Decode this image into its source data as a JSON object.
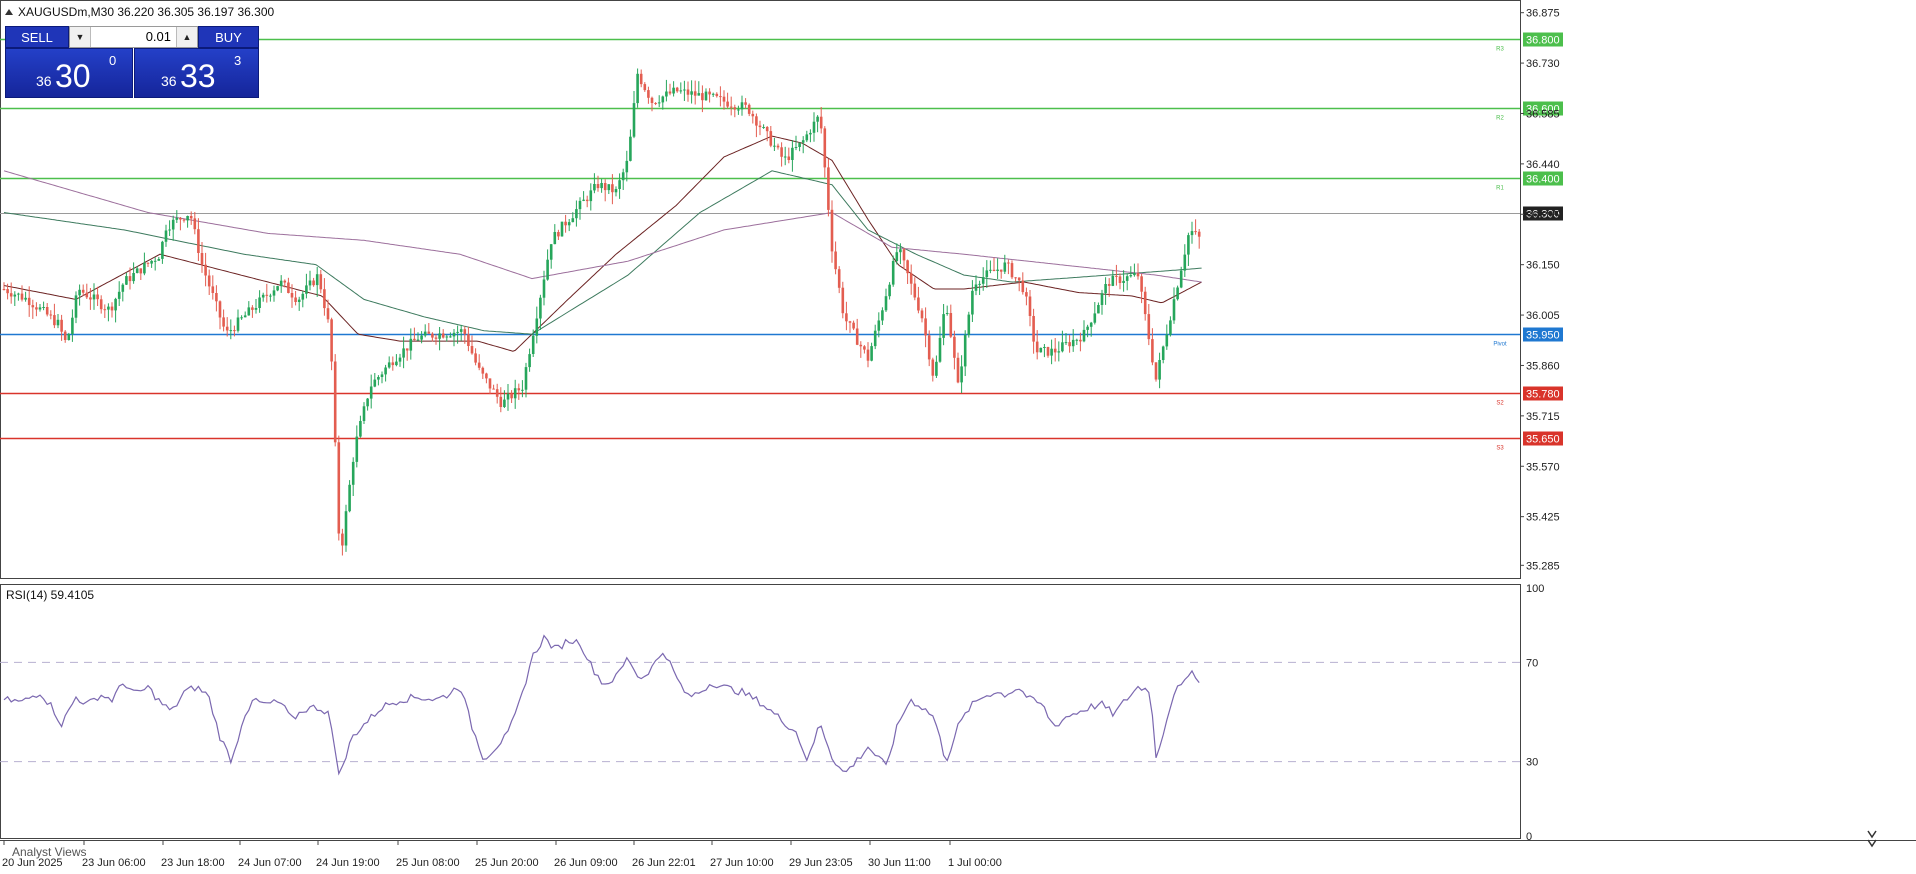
{
  "header": {
    "symbol_line": "XAUGUSDm,M30  36.220 36.305 36.197 36.300",
    "collapse_icon": "triangle-up-icon"
  },
  "trade_panel": {
    "sell_label": "SELL",
    "buy_label": "BUY",
    "lot_value": "0.01",
    "bid": {
      "small": "36",
      "big": "30",
      "sup": "0"
    },
    "ask": {
      "small": "36",
      "big": "33",
      "sup": "3"
    }
  },
  "price_axis": {
    "ticks": [
      "36.875",
      "36.730",
      "36.585",
      "36.440",
      "36.295",
      "36.150",
      "36.005",
      "35.860",
      "35.715",
      "35.570",
      "35.425",
      "35.285"
    ],
    "current_price": "36.300",
    "current_price_color": "#222222"
  },
  "levels": [
    {
      "id": "r3",
      "price": 36.8,
      "label": "36.800",
      "tag": "R3",
      "color": "#4cbf4c"
    },
    {
      "id": "r2",
      "price": 36.6,
      "label": "36.600",
      "tag": "R2",
      "color": "#4cbf4c"
    },
    {
      "id": "r1",
      "price": 36.4,
      "label": "36.400",
      "tag": "R1",
      "color": "#4cbf4c"
    },
    {
      "id": "pivot",
      "price": 35.95,
      "label": "35.950",
      "tag": "Pivot",
      "color": "#1f78d1"
    },
    {
      "id": "s2",
      "price": 35.78,
      "label": "35.780",
      "tag": "S2",
      "color": "#d9342b"
    },
    {
      "id": "s3",
      "price": 35.65,
      "label": "35.650",
      "tag": "S3",
      "color": "#d9342b"
    }
  ],
  "time_axis": [
    "20 Jun 2025",
    "23 Jun 06:00",
    "23 Jun 18:00",
    "24 Jun 07:00",
    "24 Jun 19:00",
    "25 Jun 08:00",
    "25 Jun 20:00",
    "26 Jun 09:00",
    "26 Jun 22:01",
    "27 Jun 10:00",
    "29 Jun 23:05",
    "30 Jun 11:00",
    "1 Jul 00:00"
  ],
  "rsi": {
    "label": "RSI(14) 59.4105",
    "ticks": [
      "100",
      "70",
      "30",
      "0"
    ],
    "color": "#7b68b0"
  },
  "bottom_bar": {
    "label": "Analyst Views"
  },
  "chart_data": [
    {
      "type": "candlestick",
      "symbol": "XAUGUSDm",
      "timeframe": "M30",
      "ylim": [
        35.26,
        36.9
      ],
      "grid": false,
      "candle_colors": {
        "up": "#26a65b",
        "down": "#e35d50"
      },
      "price_anchors": {
        "t": [
          0,
          20,
          45,
          52,
          62,
          88,
          100,
          130,
          135,
          155,
          165,
          175,
          185,
          200,
          230,
          245,
          262,
          272,
          280,
          292,
          305,
          325,
          345,
          360,
          383,
          395,
          415,
          432,
          456,
          470,
          495,
          510,
          520,
          528,
          540,
          560,
          590,
          620,
          650,
          665,
          672,
          680,
          690,
          700,
          720,
          730,
          745,
          765,
          775,
          785,
          795,
          808,
          835,
          850,
          860,
          875,
          900,
          920,
          945,
          960,
          975,
          988,
          998
        ],
        "price": [
          36.08,
          36.05,
          35.98,
          35.92,
          36.08,
          36.02,
          36.1,
          36.18,
          36.26,
          36.3,
          36.15,
          36.05,
          35.95,
          36.0,
          36.1,
          36.05,
          36.12,
          35.95,
          35.3,
          35.62,
          35.8,
          35.88,
          35.94,
          35.95,
          35.96,
          35.85,
          35.75,
          35.8,
          36.22,
          36.28,
          36.38,
          36.36,
          36.45,
          36.7,
          36.62,
          36.65,
          36.63,
          36.6,
          36.45,
          36.5,
          36.54,
          36.58,
          36.2,
          36.0,
          35.88,
          36.0,
          36.2,
          36.0,
          35.82,
          36.05,
          35.8,
          36.1,
          36.15,
          36.08,
          35.9,
          35.9,
          35.95,
          36.1,
          36.12,
          35.82,
          36.05,
          36.25,
          36.22
        ]
      },
      "moving_averages": [
        {
          "color": "#6b2222",
          "t": [
            0,
            60,
            130,
            175,
            220,
            265,
            295,
            330,
            395,
            425,
            440,
            470,
            510,
            560,
            600,
            640,
            665,
            690,
            720,
            745,
            775,
            800,
            850,
            895,
            940,
            965,
            998
          ],
          "price": [
            36.09,
            36.05,
            36.18,
            36.14,
            36.1,
            36.06,
            35.95,
            35.93,
            35.93,
            35.9,
            35.95,
            36.05,
            36.18,
            36.32,
            36.46,
            36.52,
            36.5,
            36.45,
            36.28,
            36.15,
            36.08,
            36.08,
            36.1,
            36.07,
            36.06,
            36.04,
            36.1
          ]
        },
        {
          "color": "#3d7a5e",
          "t": [
            0,
            100,
            200,
            260,
            300,
            350,
            400,
            440,
            520,
            580,
            640,
            690,
            720,
            760,
            800,
            840,
            880,
            920,
            960,
            998
          ],
          "price": [
            36.3,
            36.25,
            36.18,
            36.15,
            36.05,
            36.0,
            35.96,
            35.95,
            36.12,
            36.3,
            36.42,
            36.38,
            36.25,
            36.18,
            36.12,
            36.1,
            36.11,
            36.12,
            36.13,
            36.14
          ]
        },
        {
          "color": "#9c6f9c",
          "t": [
            0,
            120,
            220,
            300,
            380,
            440,
            520,
            600,
            690,
            740,
            800,
            880,
            960,
            998
          ],
          "price": [
            36.42,
            36.3,
            36.24,
            36.22,
            36.18,
            36.11,
            36.16,
            36.25,
            36.3,
            36.2,
            36.18,
            36.15,
            36.12,
            36.1
          ]
        }
      ]
    },
    {
      "type": "line",
      "name": "RSI(14)",
      "ylim": [
        0,
        100
      ],
      "levels": [
        70,
        30
      ],
      "x": [
        0,
        15,
        30,
        40,
        48,
        60,
        70,
        80,
        90,
        100,
        110,
        120,
        130,
        140,
        150,
        160,
        170,
        180,
        190,
        200,
        210,
        215,
        230,
        240,
        250,
        260,
        270,
        280,
        290,
        300,
        315,
        330,
        345,
        360,
        370,
        380,
        390,
        400,
        410,
        420,
        430,
        440,
        450,
        460,
        470,
        480,
        490,
        500,
        510,
        520,
        530,
        540,
        550,
        560,
        570,
        580,
        590,
        600,
        615,
        630,
        645,
        660,
        670,
        680,
        690,
        700,
        710,
        720,
        735,
        745,
        755,
        765,
        775,
        785,
        795,
        805,
        815,
        825,
        835,
        845,
        855,
        865,
        875,
        885,
        895,
        905,
        915,
        925,
        935,
        945,
        955,
        960,
        965,
        975,
        985,
        990,
        998
      ],
      "y": [
        55,
        54,
        58,
        52,
        45,
        56,
        53,
        57,
        55,
        62,
        57,
        60,
        54,
        50,
        58,
        60,
        57,
        40,
        30,
        49,
        55,
        53,
        54,
        47,
        51,
        52,
        50,
        24,
        40,
        45,
        52,
        55,
        56,
        55,
        57,
        61,
        44,
        31,
        36,
        41,
        54,
        72,
        80,
        75,
        79,
        78,
        68,
        61,
        64,
        72,
        63,
        68,
        75,
        64,
        56,
        58,
        62,
        60,
        58,
        54,
        48,
        42,
        30,
        46,
        32,
        25,
        30,
        36,
        28,
        45,
        55,
        52,
        48,
        30,
        44,
        52,
        56,
        58,
        57,
        60,
        55,
        53,
        44,
        48,
        50,
        52,
        53,
        49,
        55,
        60,
        59,
        32,
        40,
        58,
        62,
        68,
        59.4
      ]
    }
  ]
}
